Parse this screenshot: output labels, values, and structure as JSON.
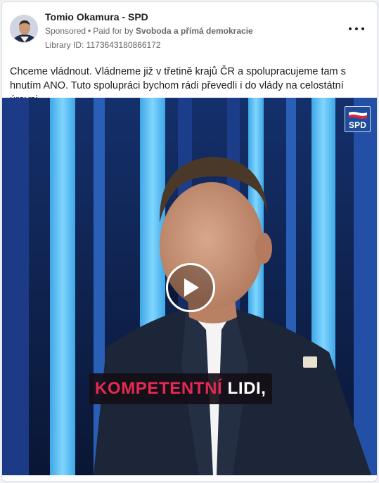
{
  "post": {
    "page_name": "Tomio Okamura - SPD",
    "sponsored_label": "Sponsored",
    "separator": "•",
    "paid_for_prefix": "Paid for by",
    "payer_name": "Svoboda a přímá demokracie",
    "library_id": "Library ID: 1173643180866172",
    "body_text": "Chceme vládnout. Vládneme již v třetině krajů ČR a spolupracujeme tam s hnutím ANO. Tuto spolupráci bychom rádi převedli i do vlády na celostátní úrovni."
  },
  "video": {
    "logo_text": "SPD",
    "caption_highlight": "KOMPETENTNÍ",
    "caption_rest": "LIDI,"
  },
  "icons": {
    "more": "more-horizontal-icon",
    "play": "play-icon",
    "logo": "spd-logo-icon"
  },
  "colors": {
    "caption_highlight": "#e62954",
    "text_primary": "#1c1e21",
    "text_secondary": "#65676b",
    "logo_blue": "#1f4d9c"
  }
}
